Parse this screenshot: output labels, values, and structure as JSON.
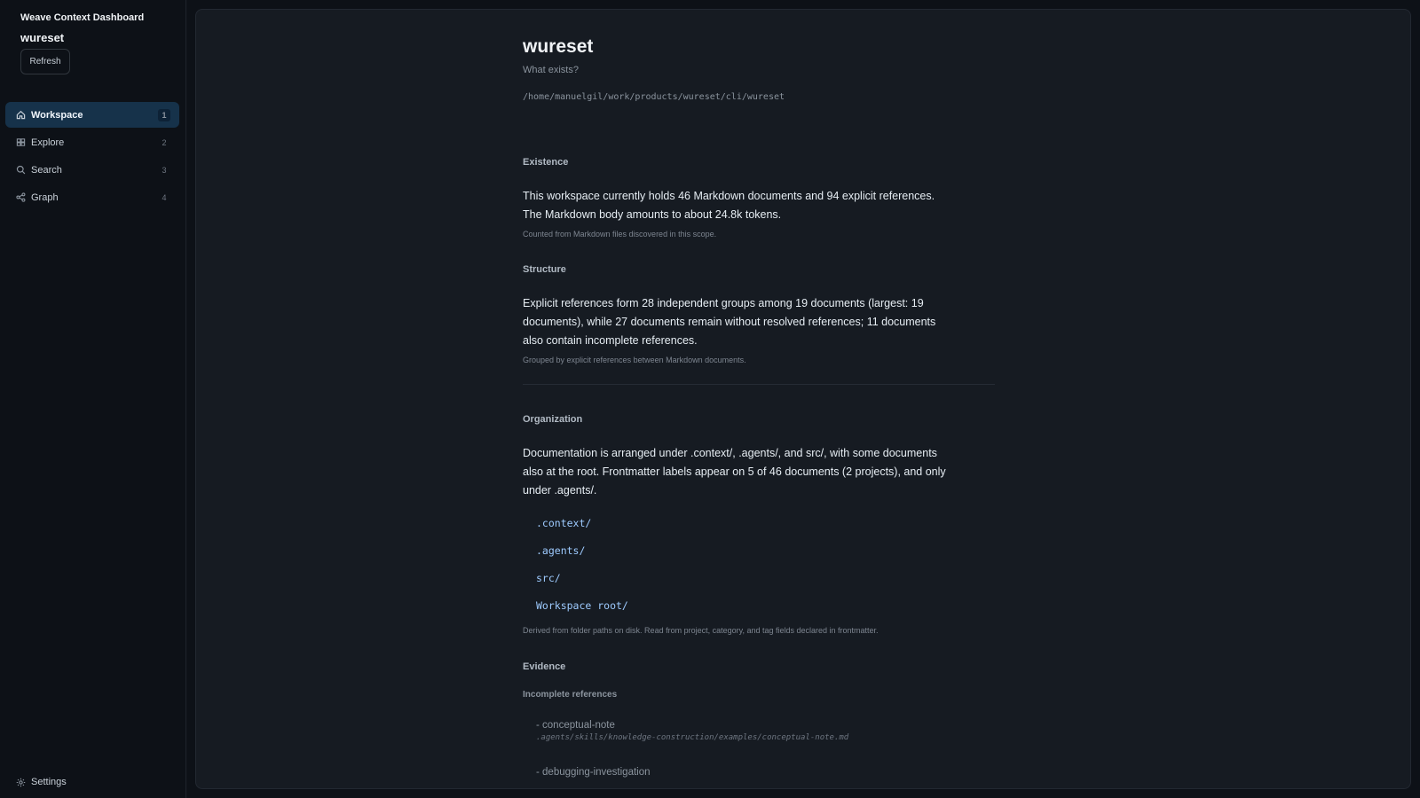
{
  "app": {
    "title": "Weave Context Dashboard",
    "workspace_name": "wureset",
    "refresh_label": "Refresh"
  },
  "nav": {
    "items": [
      {
        "label": "Workspace",
        "badge": "1",
        "icon": "home-icon",
        "active": true
      },
      {
        "label": "Explore",
        "badge": "2",
        "icon": "grid-icon",
        "active": false
      },
      {
        "label": "Search",
        "badge": "3",
        "icon": "search-icon",
        "active": false
      },
      {
        "label": "Graph",
        "badge": "4",
        "icon": "share-icon",
        "active": false
      }
    ],
    "settings_label": "Settings"
  },
  "page": {
    "title": "wureset",
    "subtitle": "What exists?",
    "path": "/home/manuelgil/work/products/wureset/cli/wureset"
  },
  "sections": {
    "existence": {
      "heading": "Existence",
      "body": "This workspace currently holds 46 Markdown documents and 94 explicit references. The Markdown body amounts to about 24.8k tokens.",
      "note": "Counted from Markdown files discovered in this scope."
    },
    "structure": {
      "heading": "Structure",
      "body": "Explicit references form 28 independent groups among 19 documents (largest: 19 documents), while 27 documents remain without resolved references; 11 documents also contain incomplete references.",
      "note": "Grouped by explicit references between Markdown documents."
    },
    "organization": {
      "heading": "Organization",
      "body": "Documentation is arranged under .context/, .agents/, and src/, with some documents also at the root. Frontmatter labels appear on 5 of 46 documents (2 projects), and only under .agents/.",
      "folders": [
        ".context/",
        ".agents/",
        "src/",
        "Workspace root/"
      ],
      "note": "Derived from folder paths on disk. Read from project, category, and tag fields declared in frontmatter."
    },
    "evidence": {
      "heading": "Evidence",
      "subheading": "Incomplete references",
      "items": [
        {
          "name": "- conceptual-note",
          "path": ".agents/skills/knowledge-construction/examples/conceptual-note.md"
        },
        {
          "name": "- debugging-investigation",
          "path": ""
        }
      ]
    }
  },
  "colors": {
    "background": "#0d1117",
    "panel": "#161b22",
    "active_nav": "#16324a",
    "folder_link": "#9ecbff"
  }
}
